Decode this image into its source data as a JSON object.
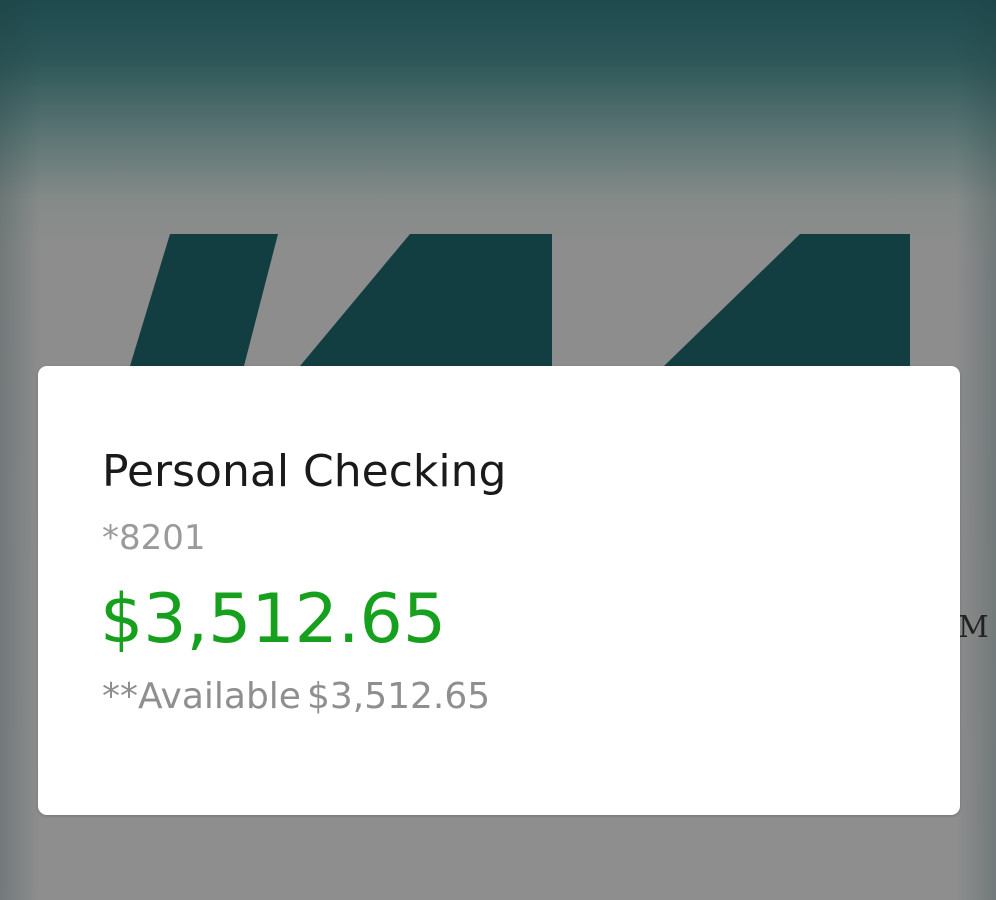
{
  "colors": {
    "background_top": "#1e4a4e",
    "background_bottom": "#8e8e8e",
    "logo_color": "#123e42",
    "card_background": "#ffffff",
    "balance_green": "#17a01d",
    "secondary_text": "#8f8f8f"
  },
  "background": {
    "logo_icon": "brand-logo-icon",
    "side_glyph": "M"
  },
  "account_card": {
    "name": "Personal Checking",
    "number": "*8201",
    "balance": "$3,512.65",
    "available_label": "**Available",
    "available_amount": "$3,512.65"
  }
}
